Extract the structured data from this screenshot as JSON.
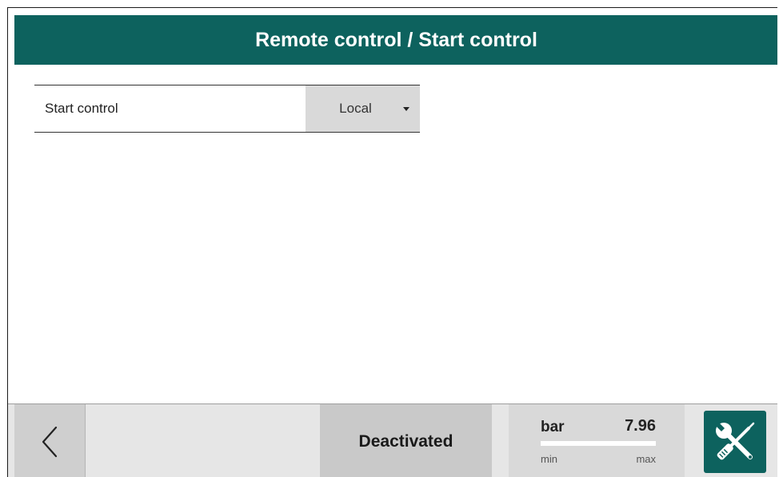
{
  "header": {
    "title": "Remote control / Start control"
  },
  "settings": {
    "start_control": {
      "label": "Start control",
      "selected": "Local"
    }
  },
  "footer": {
    "back_icon": "chevron-left-icon",
    "status": "Deactivated",
    "pressure": {
      "unit": "bar",
      "value": "7.96",
      "min_label": "min",
      "max_label": "max",
      "level_fraction": 1.0
    },
    "tools_icon": "wrench-screwdriver-icon"
  },
  "colors": {
    "header_bg": "#0d625e",
    "tools_button_bg": "#0d625e",
    "footer_bg": "#e6e6e6",
    "select_bg": "#d9d9d9"
  }
}
